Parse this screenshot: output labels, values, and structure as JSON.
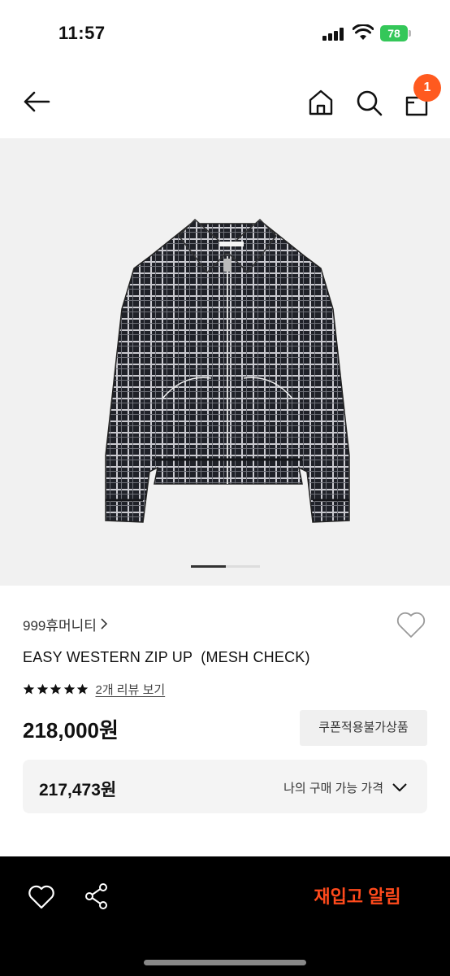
{
  "status_bar": {
    "time": "11:57",
    "battery": "78"
  },
  "nav": {
    "cart_count": "1",
    "icons": [
      "arrow-left-icon",
      "home-icon",
      "search-icon",
      "shopping-bag-icon"
    ]
  },
  "gallery": {
    "image": "plaid-zip-up-jacket",
    "current_slide_fraction": 0.5
  },
  "product": {
    "brand": "999휴머니티",
    "title": "EASY WESTERN ZIP UP  (MESH CHECK)",
    "rating_stars": 5,
    "review_link": "2개 리뷰 보기",
    "price": "218,000원",
    "coupon_label": "쿠폰적용불가상품",
    "my_price": "217,473원",
    "my_price_label": "나의 구매 가능 가격"
  },
  "bottom_bar": {
    "restock_label": "재입고 알림"
  },
  "colors": {
    "accent": "#ff5a1f",
    "restock_text": "#ff4a1c",
    "battery": "#34c759"
  }
}
